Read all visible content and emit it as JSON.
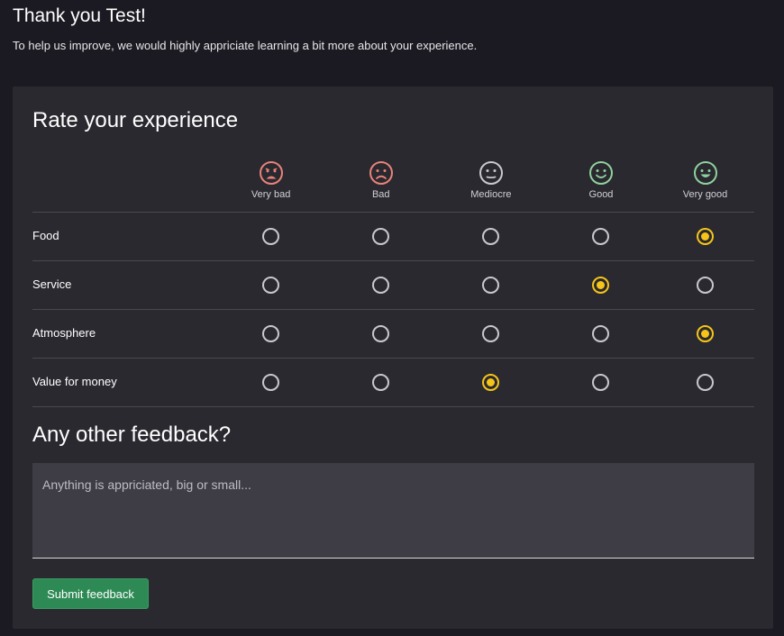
{
  "header": {
    "title": "Thank you Test!",
    "intro": "To help us improve, we would highly appriciate learning a bit more about your experience."
  },
  "rating": {
    "title": "Rate your experience",
    "options": [
      {
        "label": "Very bad",
        "icon": "very-bad-face-icon",
        "color": "#e8837a"
      },
      {
        "label": "Bad",
        "icon": "bad-face-icon",
        "color": "#e8837a"
      },
      {
        "label": "Mediocre",
        "icon": "neutral-face-icon",
        "color": "#c9c9cd"
      },
      {
        "label": "Good",
        "icon": "good-face-icon",
        "color": "#8fd19e"
      },
      {
        "label": "Very good",
        "icon": "very-good-face-icon",
        "color": "#8fd19e"
      }
    ],
    "rows": [
      {
        "label": "Food",
        "selected": 4
      },
      {
        "label": "Service",
        "selected": 3
      },
      {
        "label": "Atmosphere",
        "selected": 4
      },
      {
        "label": "Value for money",
        "selected": 2
      }
    ],
    "selected_color": "#f5c518"
  },
  "feedback": {
    "title": "Any other feedback?",
    "placeholder": "Anything is appriciated, big or small...",
    "value": ""
  },
  "submit": {
    "label": "Submit feedback",
    "color": "#2e8a55"
  }
}
